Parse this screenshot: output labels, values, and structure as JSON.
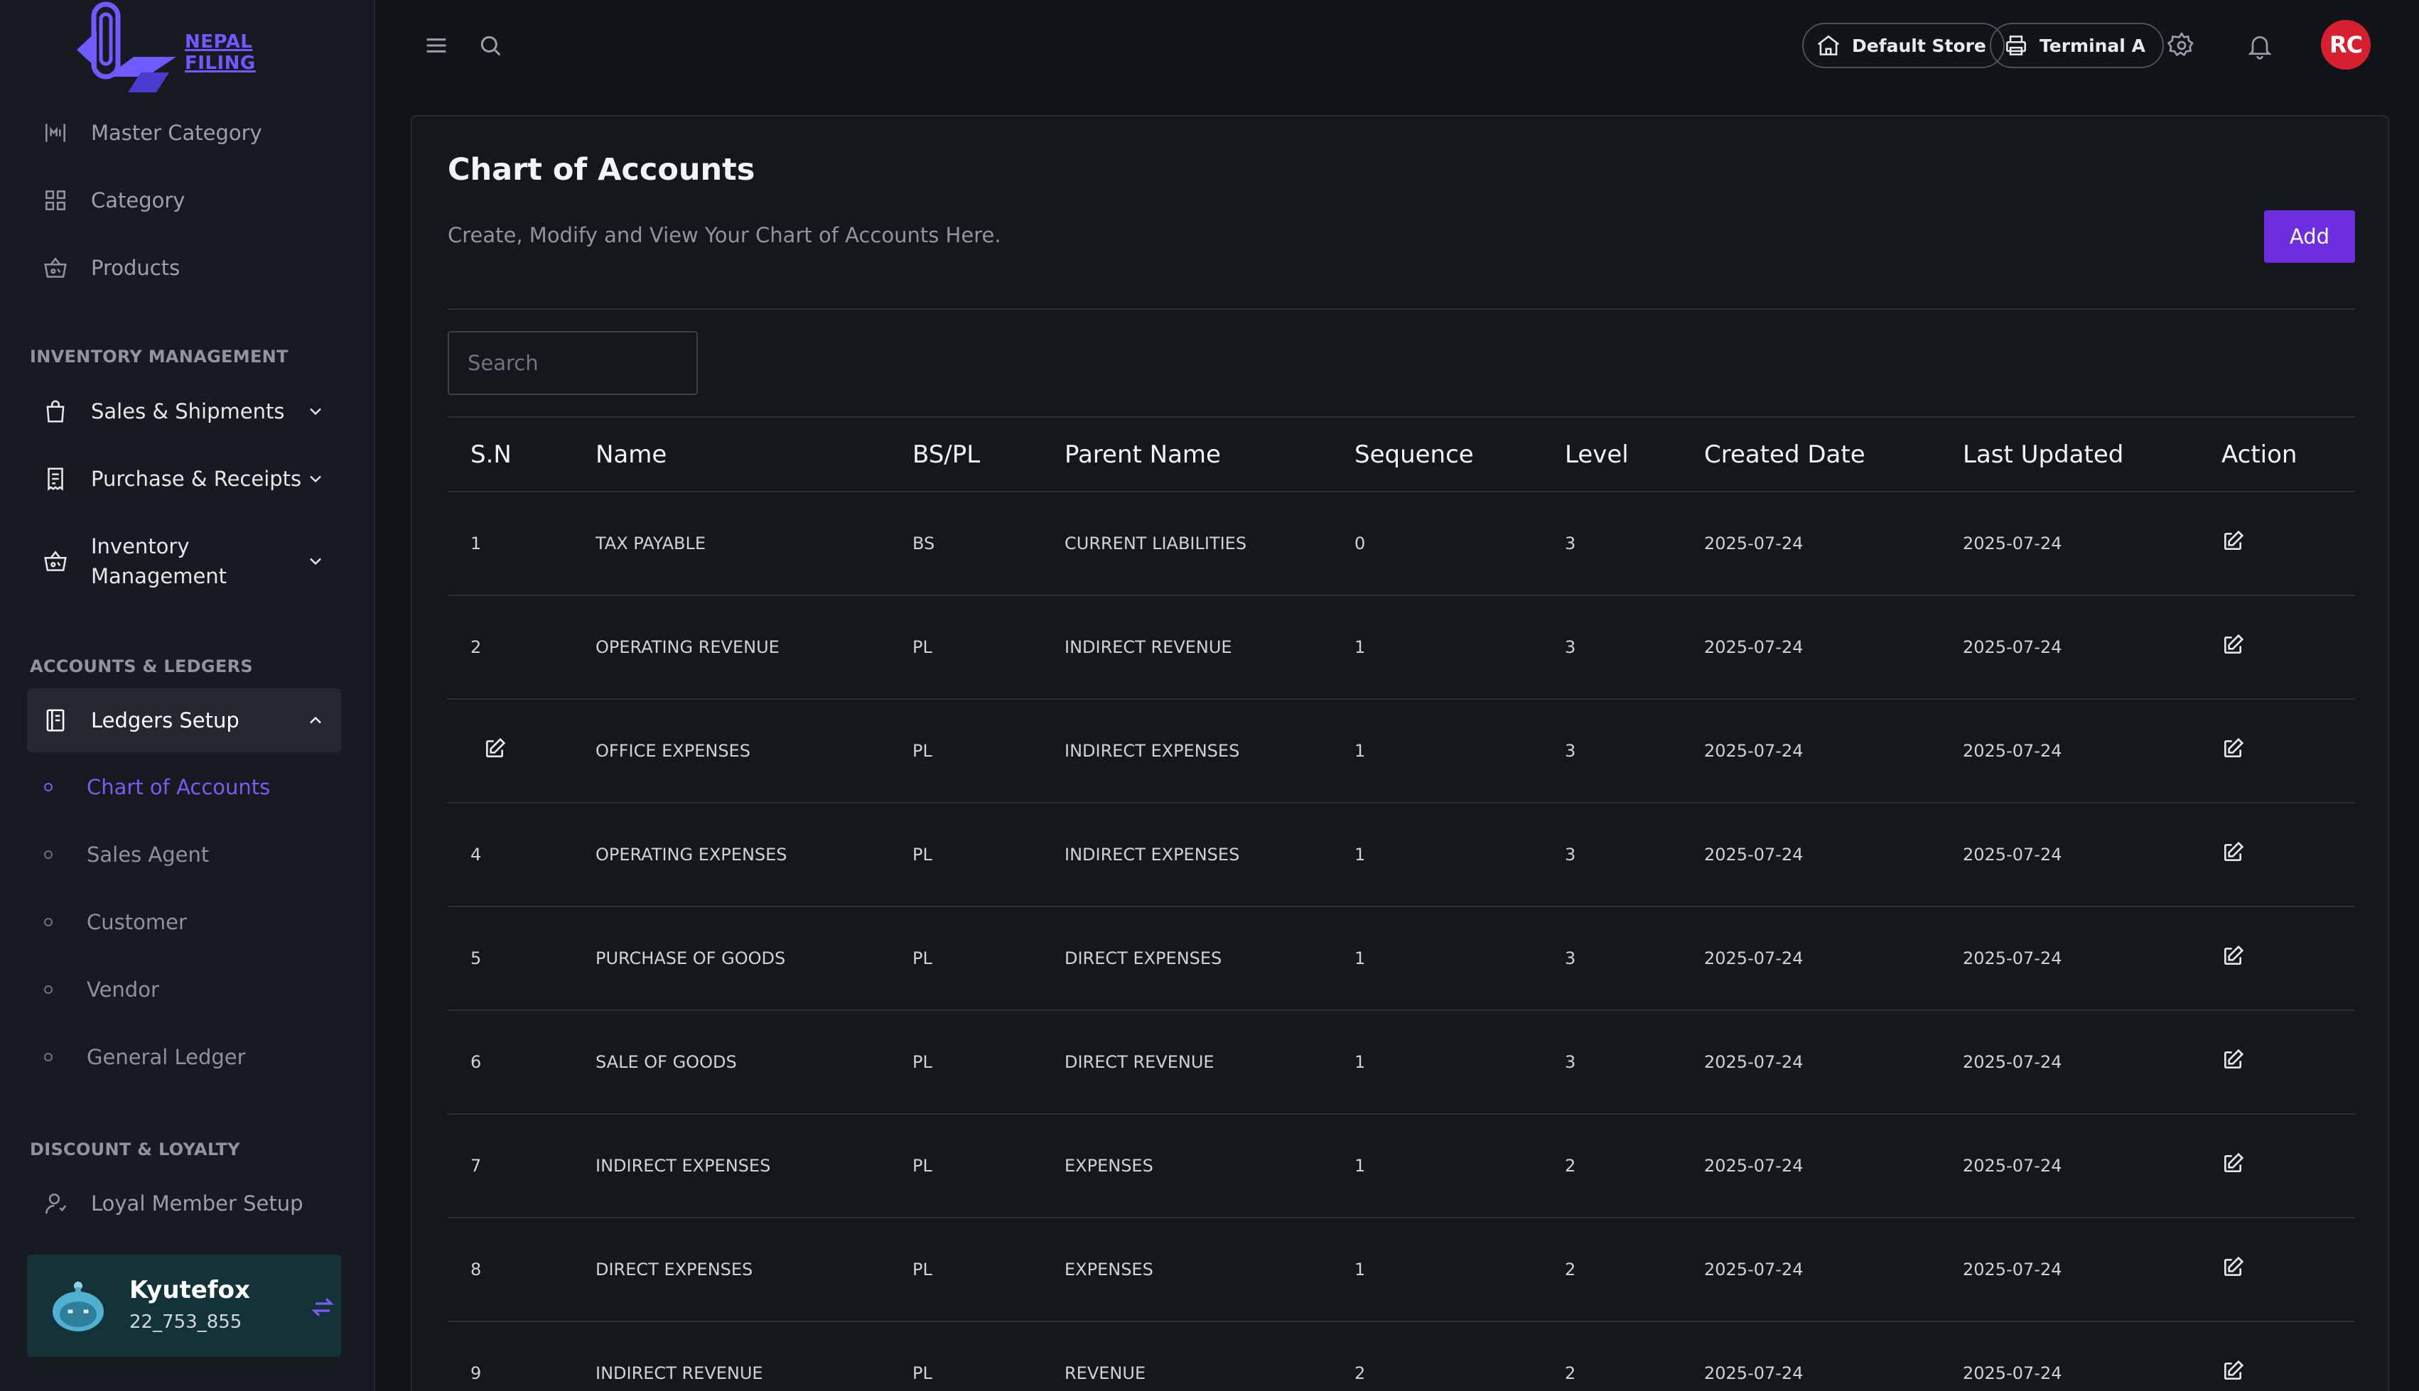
{
  "brand": {
    "logo_text": "NEPAL FILING"
  },
  "sidebar": {
    "top_items": [
      {
        "label": "Master Category",
        "icon": "master-category-icon"
      },
      {
        "label": "Category",
        "icon": "grid-icon"
      },
      {
        "label": "Products",
        "icon": "basket-icon"
      }
    ],
    "sections": [
      {
        "label": "INVENTORY MANAGEMENT",
        "items": [
          {
            "label": "Sales & Shipments",
            "icon": "shopping-bag-icon"
          },
          {
            "label": "Purchase & Receipts",
            "icon": "receipt-icon"
          },
          {
            "label": "Inventory Management",
            "label_line1": "Inventory",
            "label_line2": "Management",
            "icon": "inventory-basket-icon"
          }
        ]
      },
      {
        "label": "ACCOUNTS & LEDGERS",
        "items": [
          {
            "label": "Ledgers Setup",
            "icon": "ledger-icon",
            "expanded": true
          }
        ],
        "subitems": [
          "Chart of Accounts",
          "Sales Agent",
          "Customer",
          "Vendor",
          "General Ledger"
        ],
        "active_subitem": "Chart of Accounts"
      },
      {
        "label": "DISCOUNT & LOYALTY",
        "items": [
          {
            "label": "Loyal Member Setup",
            "icon": "member-icon"
          }
        ]
      }
    ],
    "user": {
      "name": "Kyutefox",
      "id": "22_753_855"
    }
  },
  "topbar": {
    "store_label": "Default Store",
    "terminal_label": "Terminal A",
    "avatar_initials": "RC"
  },
  "page": {
    "title": "Chart of Accounts",
    "subtitle": "Create, Modify and View Your Chart of Accounts Here.",
    "add_label": "Add",
    "search_placeholder": "Search"
  },
  "table": {
    "columns": [
      "S.N",
      "Name",
      "BS/PL",
      "Parent Name",
      "Sequence",
      "Level",
      "Created Date",
      "Last Updated",
      "Action"
    ],
    "rows": [
      {
        "sn": "1",
        "name": "TAX PAYABLE",
        "bspl": "BS",
        "parent": "CURRENT LIABILITIES",
        "sequence": "0",
        "level": "3",
        "created": "2025-07-24",
        "updated": "2025-07-24"
      },
      {
        "sn": "2",
        "name": "OPERATING REVENUE",
        "bspl": "PL",
        "parent": "INDIRECT REVENUE",
        "sequence": "1",
        "level": "3",
        "created": "2025-07-24",
        "updated": "2025-07-24"
      },
      {
        "sn": "",
        "name": "OFFICE EXPENSES",
        "bspl": "PL",
        "parent": "INDIRECT EXPENSES",
        "sequence": "1",
        "level": "3",
        "created": "2025-07-24",
        "updated": "2025-07-24",
        "sn_is_edit_icon": true
      },
      {
        "sn": "4",
        "name": "OPERATING EXPENSES",
        "bspl": "PL",
        "parent": "INDIRECT EXPENSES",
        "sequence": "1",
        "level": "3",
        "created": "2025-07-24",
        "updated": "2025-07-24"
      },
      {
        "sn": "5",
        "name": "PURCHASE OF GOODS",
        "bspl": "PL",
        "parent": "DIRECT EXPENSES",
        "sequence": "1",
        "level": "3",
        "created": "2025-07-24",
        "updated": "2025-07-24"
      },
      {
        "sn": "6",
        "name": "SALE OF GOODS",
        "bspl": "PL",
        "parent": "DIRECT REVENUE",
        "sequence": "1",
        "level": "3",
        "created": "2025-07-24",
        "updated": "2025-07-24"
      },
      {
        "sn": "7",
        "name": "INDIRECT EXPENSES",
        "bspl": "PL",
        "parent": "EXPENSES",
        "sequence": "1",
        "level": "2",
        "created": "2025-07-24",
        "updated": "2025-07-24"
      },
      {
        "sn": "8",
        "name": "DIRECT EXPENSES",
        "bspl": "PL",
        "parent": "EXPENSES",
        "sequence": "1",
        "level": "2",
        "created": "2025-07-24",
        "updated": "2025-07-24"
      },
      {
        "sn": "9",
        "name": "INDIRECT REVENUE",
        "bspl": "PL",
        "parent": "REVENUE",
        "sequence": "2",
        "level": "2",
        "created": "2025-07-24",
        "updated": "2025-07-24"
      }
    ]
  },
  "colors": {
    "accent": "#6d2ee0",
    "active_link": "#7b5cf0",
    "avatar_bg": "#d62030",
    "user_card_bg": "#143338",
    "background": "#111418"
  }
}
